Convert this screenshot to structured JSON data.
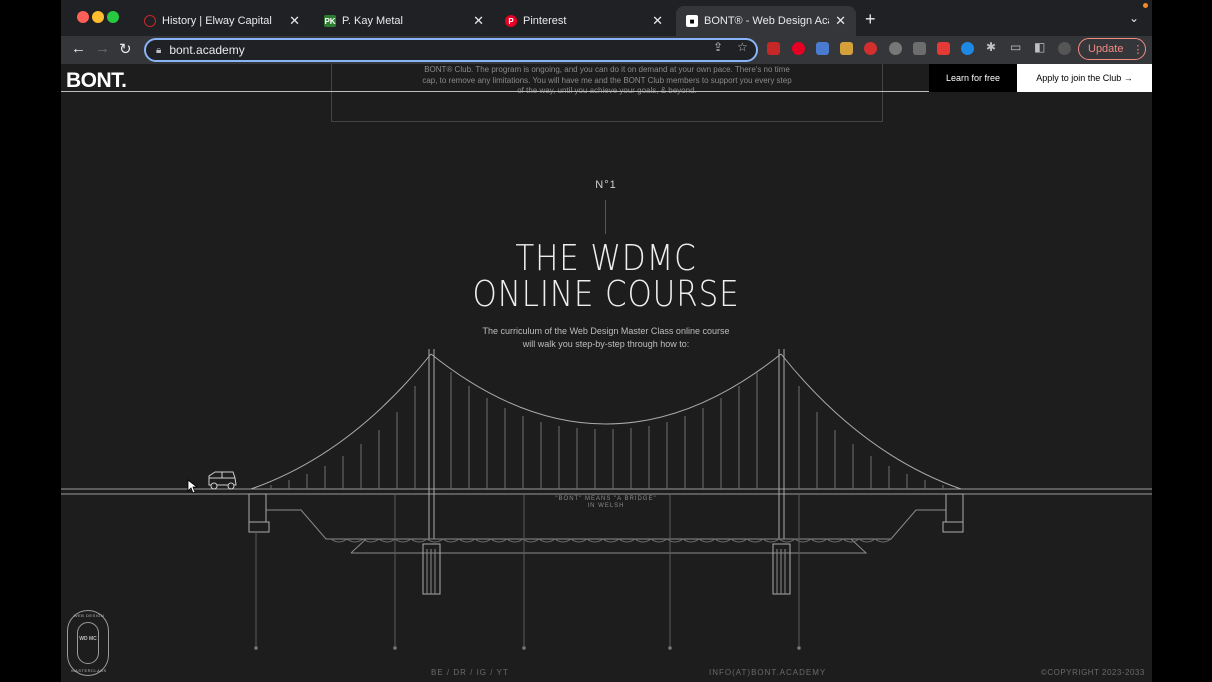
{
  "browser": {
    "tabs": [
      {
        "title": "History | Elway Capital",
        "favicon": "elway-logo",
        "color": "#c62828"
      },
      {
        "title": "P. Kay Metal",
        "favicon": "pk-logo",
        "color": "#2e7d32",
        "favicon_text": "PK"
      },
      {
        "title": "Pinterest",
        "favicon": "pinterest-logo",
        "color": "#e60023"
      },
      {
        "title": "BONT® - Web Design Academ",
        "favicon": "bont-logo",
        "color": "#ffffff"
      }
    ],
    "new_tab_label": "+",
    "url": "bont.academy",
    "update_label": "Update",
    "accent": "#8ab4f8",
    "update_color": "#f28b82"
  },
  "site": {
    "logo": "BONT.",
    "intro_text": "BONT® Club. The program is ongoing, and you can do it on demand at your own pace. There's no time cap, to remove any limitations. You will have me and the BONT Club members to support you every step of the way, until you achieve your goals, & beyond.",
    "learn_button": "Learn for free",
    "apply_button": "Apply to join the Club →",
    "number_label": "N°1",
    "headline_line1": "THE WDMC",
    "headline_line2": "ONLINE COURSE",
    "subheading": "The curriculum of the Web Design Master Class online course will walk you step-by-step through how to:",
    "bridge_caption_1": "\"BONT\" MEANS \"A BRIDGE\"",
    "bridge_caption_2": "IN WELSH",
    "footer_social": "BE / DR / IG / YT",
    "footer_email": "INFO(AT)BONT.ACADEMY",
    "footer_copyright": "©COPYRIGHT 2023-2033",
    "badge_center": "WD MC",
    "badge_top": "WEB DESIGN",
    "badge_bottom": "MASTERCLASS"
  }
}
